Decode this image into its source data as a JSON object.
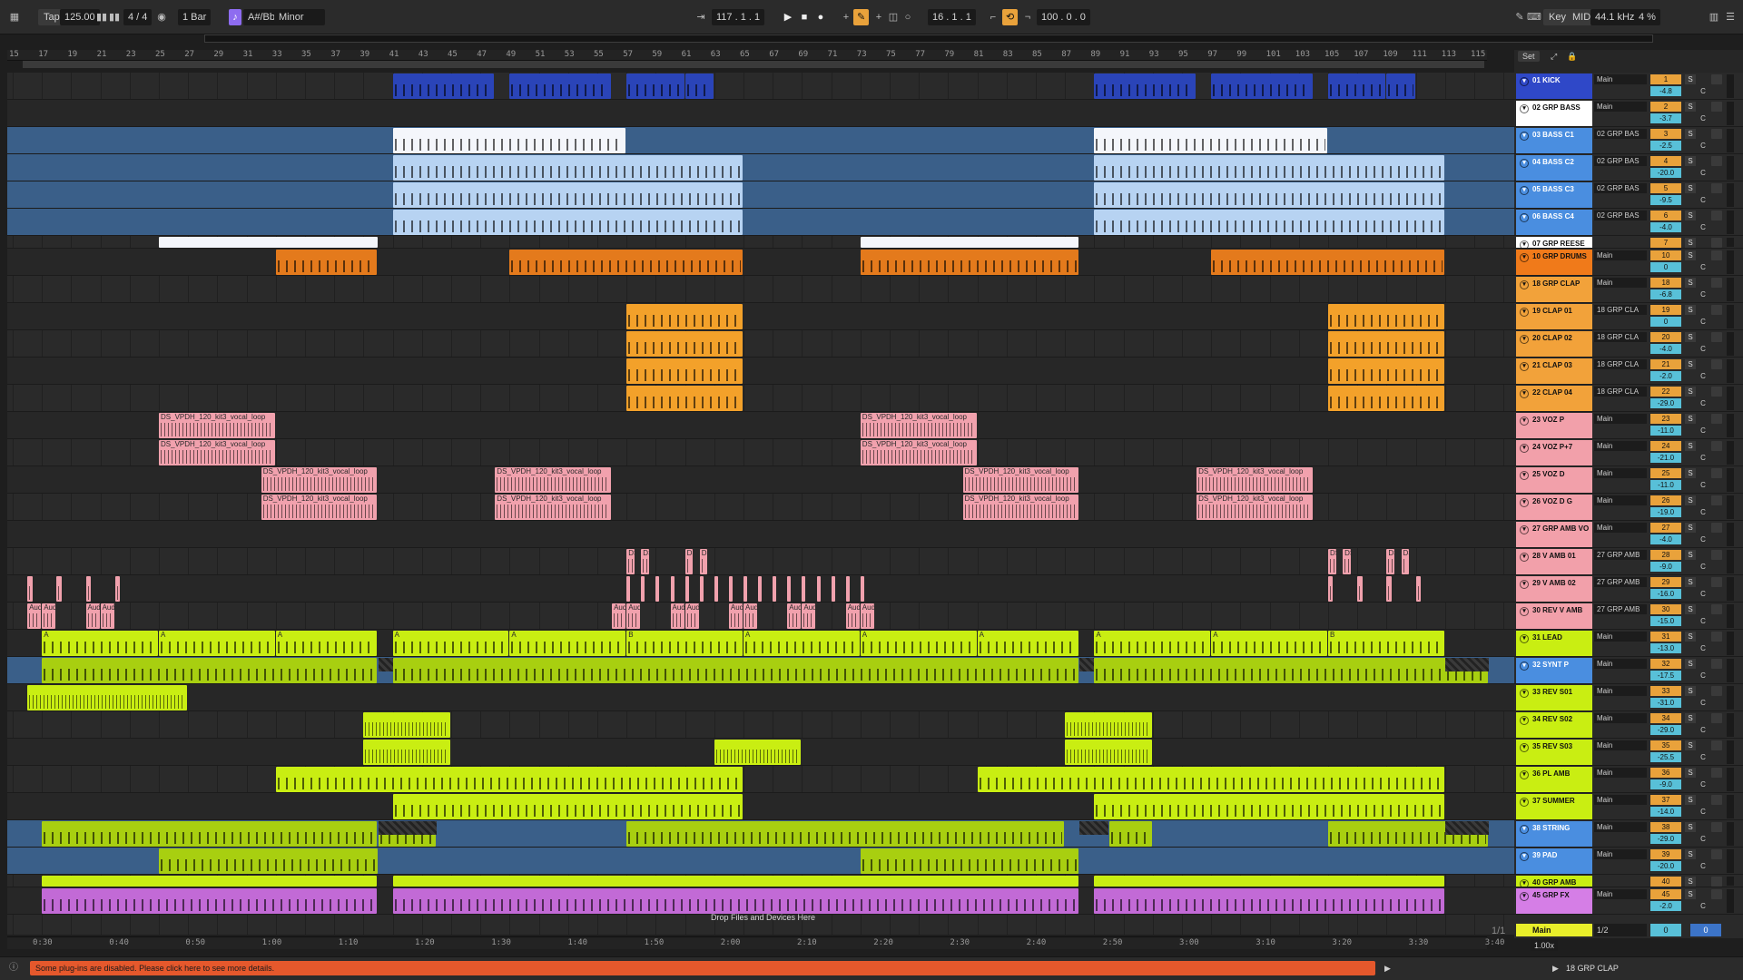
{
  "transport": {
    "tap": "Tap",
    "tempo": "125.00",
    "meter": "4 / 4",
    "quantize": "1 Bar",
    "scale_root": "A#/Bb",
    "scale_mode": "Minor",
    "position": "117 .  1 .  1",
    "loop_start": "16 .  1 .  1",
    "loop_length": "100 .  0 .  0",
    "key_label": "Key",
    "midi_label": "MIDI",
    "sample_rate": "44.1 kHz",
    "cpu": "4 %"
  },
  "ruler_bars": [
    "15",
    "17",
    "19",
    "21",
    "23",
    "25",
    "27",
    "29",
    "31",
    "33",
    "35",
    "37",
    "39",
    "41",
    "43",
    "45",
    "47",
    "49",
    "51",
    "53",
    "55",
    "57",
    "59",
    "61",
    "63",
    "65",
    "67",
    "69",
    "71",
    "73",
    "75",
    "77",
    "79",
    "81",
    "83",
    "85",
    "87",
    "89",
    "91",
    "93",
    "95",
    "97",
    "99",
    "101",
    "103",
    "105",
    "107",
    "109",
    "111",
    "113",
    "115"
  ],
  "time_ticks": [
    "0:30",
    "0:40",
    "0:50",
    "1:00",
    "1:10",
    "1:20",
    "1:30",
    "1:40",
    "1:50",
    "2:00",
    "2:10",
    "2:20",
    "2:30",
    "2:40",
    "2:50",
    "3:00",
    "3:10",
    "3:20",
    "3:30",
    "3:40"
  ],
  "set_label": "Set",
  "page_indicator": "1/1",
  "drop_hint": "Drop Files and Devices Here",
  "clip_names": {
    "vocal_loop": "DS_VPDH_120_kit3_vocal_loop",
    "aud": "Aud",
    "marker_a": "A",
    "marker_b": "B",
    "ds": "DS"
  },
  "tracks": [
    {
      "name": "01 KICK",
      "route": "Main",
      "num": "1",
      "vol": "-4.8",
      "color": "#2f48c8"
    },
    {
      "name": "02 GRP BASS",
      "route": "Main",
      "num": "2",
      "vol": "-3.7",
      "color": "#ffffff"
    },
    {
      "name": "03 BASS C1",
      "route": "02 GRP BAS",
      "num": "3",
      "vol": "-2.5",
      "color": "#4a8ee0"
    },
    {
      "name": "04 BASS C2",
      "route": "02 GRP BAS",
      "num": "4",
      "vol": "-20.0",
      "color": "#4a8ee0"
    },
    {
      "name": "05 BASS C3",
      "route": "02 GRP BAS",
      "num": "5",
      "vol": "-9.5",
      "color": "#4a8ee0"
    },
    {
      "name": "06 BASS C4",
      "route": "02 GRP BAS",
      "num": "6",
      "vol": "-4.0",
      "color": "#4a8ee0"
    },
    {
      "name": "07 GRP REESE",
      "route": "",
      "num": "7",
      "vol": "",
      "color": "#ffffff"
    },
    {
      "name": "10 GRP DRUMS",
      "route": "Main",
      "num": "10",
      "vol": "0",
      "color": "#f07a1a"
    },
    {
      "name": "18 GRP CLAP",
      "route": "Main",
      "num": "18",
      "vol": "-6.8",
      "color": "#f2a23a"
    },
    {
      "name": "19 CLAP 01",
      "route": "18 GRP CLA",
      "num": "19",
      "vol": "0",
      "color": "#f2a23a"
    },
    {
      "name": "20 CLAP 02",
      "route": "18 GRP CLA",
      "num": "20",
      "vol": "-4.0",
      "color": "#f2a23a"
    },
    {
      "name": "21 CLAP 03",
      "route": "18 GRP CLA",
      "num": "21",
      "vol": "-2.0",
      "color": "#f2a23a"
    },
    {
      "name": "22 CLAP 04",
      "route": "18 GRP CLA",
      "num": "22",
      "vol": "-29.0",
      "color": "#f2a23a"
    },
    {
      "name": "23 VOZ P",
      "route": "Main",
      "num": "23",
      "vol": "-11.0",
      "color": "#f2a0aa"
    },
    {
      "name": "24 VOZ P+7",
      "route": "Main",
      "num": "24",
      "vol": "-21.0",
      "color": "#f2a0aa"
    },
    {
      "name": "25 VOZ D",
      "route": "Main",
      "num": "25",
      "vol": "-11.0",
      "color": "#f2a0aa"
    },
    {
      "name": "26 VOZ D G",
      "route": "Main",
      "num": "26",
      "vol": "-19.0",
      "color": "#f2a0aa"
    },
    {
      "name": "27 GRP AMB VO",
      "route": "Main",
      "num": "27",
      "vol": "-4.0",
      "color": "#f2a0aa"
    },
    {
      "name": "28 V AMB 01",
      "route": "27 GRP AMB",
      "num": "28",
      "vol": "-9.0",
      "color": "#f2a0aa"
    },
    {
      "name": "29 V AMB 02",
      "route": "27 GRP AMB",
      "num": "29",
      "vol": "-16.0",
      "color": "#f2a0aa"
    },
    {
      "name": "30 REV V AMB",
      "route": "27 GRP AMB",
      "num": "30",
      "vol": "-15.0",
      "color": "#f2a0aa"
    },
    {
      "name": "31 LEAD",
      "route": "Main",
      "num": "31",
      "vol": "-13.0",
      "color": "#c9ee12"
    },
    {
      "name": "32 SYNT P",
      "route": "Main",
      "num": "32",
      "vol": "-17.5",
      "color": "#4a8ee0"
    },
    {
      "name": "33 REV S01",
      "route": "Main",
      "num": "33",
      "vol": "-31.0",
      "color": "#c9ee12"
    },
    {
      "name": "34 REV S02",
      "route": "Main",
      "num": "34",
      "vol": "-29.0",
      "color": "#c9ee12"
    },
    {
      "name": "35 REV S03",
      "route": "Main",
      "num": "35",
      "vol": "-25.5",
      "color": "#c9ee12"
    },
    {
      "name": "36 PL AMB",
      "route": "Main",
      "num": "36",
      "vol": "-9.0",
      "color": "#c9ee12"
    },
    {
      "name": "37 SUMMER",
      "route": "Main",
      "num": "37",
      "vol": "-14.0",
      "color": "#c9ee12"
    },
    {
      "name": "38 STRING",
      "route": "Main",
      "num": "38",
      "vol": "-29.0",
      "color": "#4a8ee0"
    },
    {
      "name": "39 PAD",
      "route": "Main",
      "num": "39",
      "vol": "-20.0",
      "color": "#4a8ee0"
    },
    {
      "name": "40 GRP AMB",
      "route": "",
      "num": "40",
      "vol": "",
      "color": "#c9ee12"
    },
    {
      "name": "45 GRP FX",
      "route": "Main",
      "num": "45",
      "vol": "-2.0",
      "color": "#d57ee6"
    }
  ],
  "main_track": {
    "name": "Main",
    "route": "1/2",
    "vol": "0",
    "num": "0"
  },
  "zoom": "1.00x",
  "warning": "Some plug-ins are disabled. Please click here to see more details.",
  "selected_track": "18 GRP CLAP"
}
